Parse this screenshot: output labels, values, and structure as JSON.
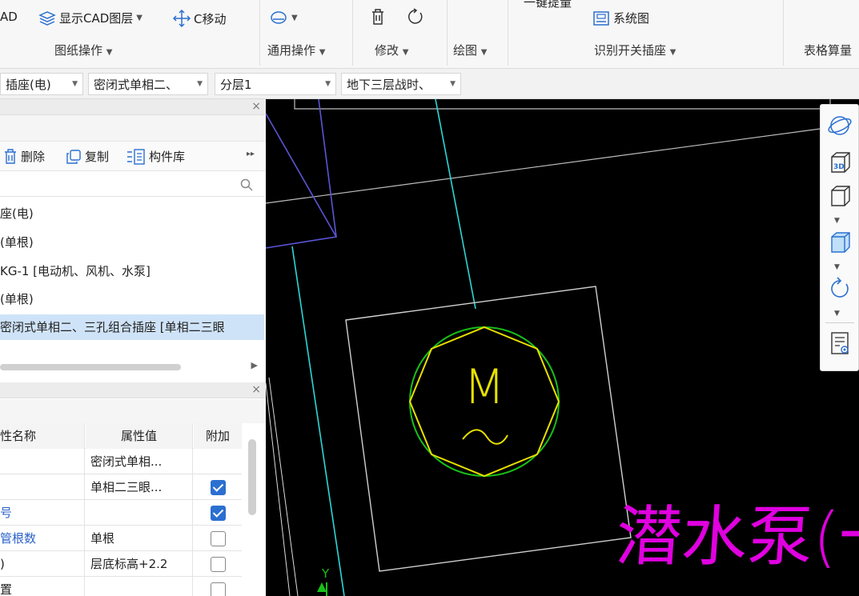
{
  "ribbon": {
    "cad_partial": "AD",
    "show_cad_layer": "显示CAD图层",
    "c_move": "C移动",
    "one_key_partial": "一键提量",
    "system_diagram": "系统图",
    "groups": {
      "drawing_ops": "图纸操作",
      "general_ops": "通用操作",
      "modify": "修改",
      "draw": "绘图",
      "identify_switch": "识别开关插座",
      "table_calc": "表格算量"
    }
  },
  "selectors": {
    "type": "插座(电)",
    "component": "密闭式单相二、",
    "layer": "分层1",
    "floor": "地下三层战时、"
  },
  "component_panel": {
    "close": "×",
    "toolbar": {
      "delete": "删除",
      "copy": "复制",
      "library": "构件库",
      "more": "▸▸"
    },
    "items": [
      "座(电)",
      "(单根)",
      "KG-1 [电动机、风机、水泵]",
      "(单根)",
      "密闭式单相二、三孔组合插座 [单相二三眼"
    ],
    "selected_index": 4
  },
  "property_panel": {
    "close": "×",
    "headers": {
      "name": "性名称",
      "value": "属性值",
      "extra": "附加"
    },
    "rows": [
      {
        "name": "",
        "value": "密闭式单相...",
        "checked": null,
        "blue": false
      },
      {
        "name": "",
        "value": "单相二三眼...",
        "checked": true,
        "blue": false
      },
      {
        "name": "号",
        "value": "",
        "checked": true,
        "blue": true
      },
      {
        "name": "管根数",
        "value": "单根",
        "checked": false,
        "blue": true
      },
      {
        "name": ")",
        "value": "层底标高+2.2",
        "checked": false,
        "blue": false
      },
      {
        "name": "置",
        "value": "",
        "checked": false,
        "blue": false
      }
    ]
  },
  "canvas": {
    "motor_letter": "M",
    "tilde": "~",
    "annotation": "潜水泵(一用一",
    "axis_label": "Y"
  },
  "colors": {
    "canvas_bg": "#000000",
    "cyan_line": "#2fd5d5",
    "purple_line": "#5b55d6",
    "yellow": "#e8e000",
    "green": "#18c018",
    "magenta": "#e000e0",
    "accent": "#2b6fd1"
  },
  "icons": {
    "layer": "layers-icon",
    "move": "move-arrows-icon",
    "general": "shape-dropdown-icon",
    "delete": "trash-icon",
    "rotate": "rotate-icon",
    "system": "system-diagram-icon",
    "search": "search-icon",
    "orbit": "orbit-icon",
    "view3d": "view-3d-icon",
    "cube": "cube-icon",
    "cube_filled": "cube-filled-icon",
    "refresh": "refresh-icon",
    "report": "report-icon"
  }
}
